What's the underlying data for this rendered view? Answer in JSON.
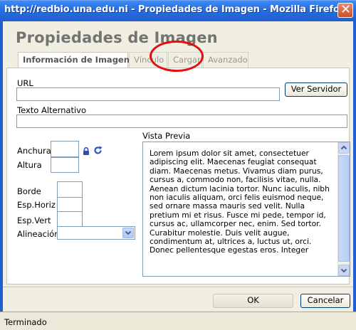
{
  "window": {
    "title": "http://redbio.una.edu.ni - Propiedades de Imagen - Mozilla Firefox",
    "close_symbol": "✕"
  },
  "dialog": {
    "title": "Propiedades de Imagen",
    "tabs": [
      {
        "label": "Información de Imagen",
        "active": true
      },
      {
        "label": "Vínculo",
        "active": false
      },
      {
        "label": "Cargar",
        "active": false
      },
      {
        "label": "Avanzado",
        "active": false
      }
    ]
  },
  "form": {
    "url_label": "URL",
    "url_value": "",
    "browse_server_label": "Ver Servidor",
    "alt_text_label": "Texto Alternativo",
    "alt_text_value": "",
    "width_label": "Anchura",
    "height_label": "Altura",
    "border_label": "Borde",
    "hspace_label": "Esp.Horiz",
    "vspace_label": "Esp.Vert",
    "align_label": "Alineación",
    "align_value": ""
  },
  "preview": {
    "label": "Vista Previa",
    "text": "Lorem ipsum dolor sit amet, consectetuer adipiscing elit. Maecenas feugiat consequat diam. Maecenas metus. Vivamus diam purus, cursus a, commodo non, facilisis vitae, nulla. Aenean dictum lacinia tortor. Nunc iaculis, nibh non iaculis aliquam, orci felis euismod neque, sed ornare massa mauris sed velit. Nulla pretium mi et risus. Fusce mi pede, tempor id, cursus ac, ullamcorper nec, enim. Sed tortor. Curabitur molestie. Duis velit augue, condimentum at, ultrices a, luctus ut, orci. Donec pellentesque egestas eros. Integer"
  },
  "buttons": {
    "ok_label": "OK",
    "cancel_label": "Cancelar"
  },
  "status": {
    "text": "Terminado"
  },
  "colors": {
    "titlebar": "#2a6fe0",
    "annotation": "#e01010",
    "lock_icon": "#2c4fb0",
    "reset_icon": "#2a55c8"
  },
  "icons": {
    "lock": "lock-icon",
    "reset_size": "refresh-icon",
    "dropdown": "chevron-down-icon"
  }
}
